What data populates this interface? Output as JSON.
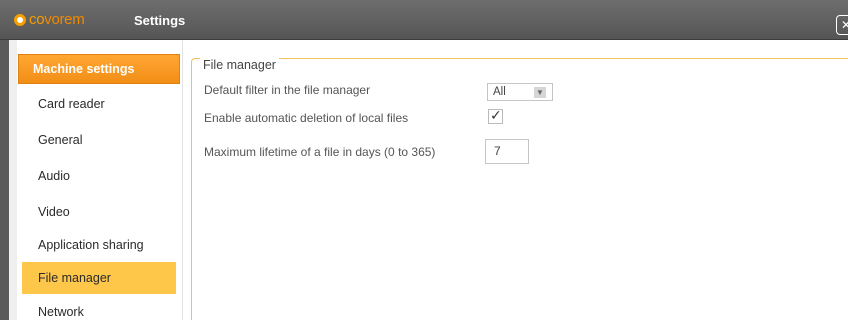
{
  "app": {
    "logo_prefix": "co",
    "logo_suffix": "vorem",
    "window_title": "Settings",
    "close_label": "✕"
  },
  "sidebar": {
    "header": "Machine settings",
    "items": [
      {
        "label": "Card reader",
        "selected": false
      },
      {
        "label": "General",
        "selected": false
      },
      {
        "label": "Audio",
        "selected": false
      },
      {
        "label": "Video",
        "selected": false
      },
      {
        "label": "Application sharing",
        "selected": false
      },
      {
        "label": "File manager",
        "selected": true
      },
      {
        "label": "Network",
        "selected": false
      }
    ]
  },
  "file_manager": {
    "legend": "File manager",
    "default_filter_label": "Default filter in the file manager",
    "default_filter_value": "All",
    "auto_delete_label": "Enable automatic deletion of local files",
    "auto_delete_checked": true,
    "lifetime_label": "Maximum lifetime of a file in days (0 to 365)",
    "lifetime_value": "7"
  },
  "colors": {
    "accent": "#f28e16",
    "selected_item": "#ffc74a",
    "titlebar": "#5f5f5f"
  }
}
